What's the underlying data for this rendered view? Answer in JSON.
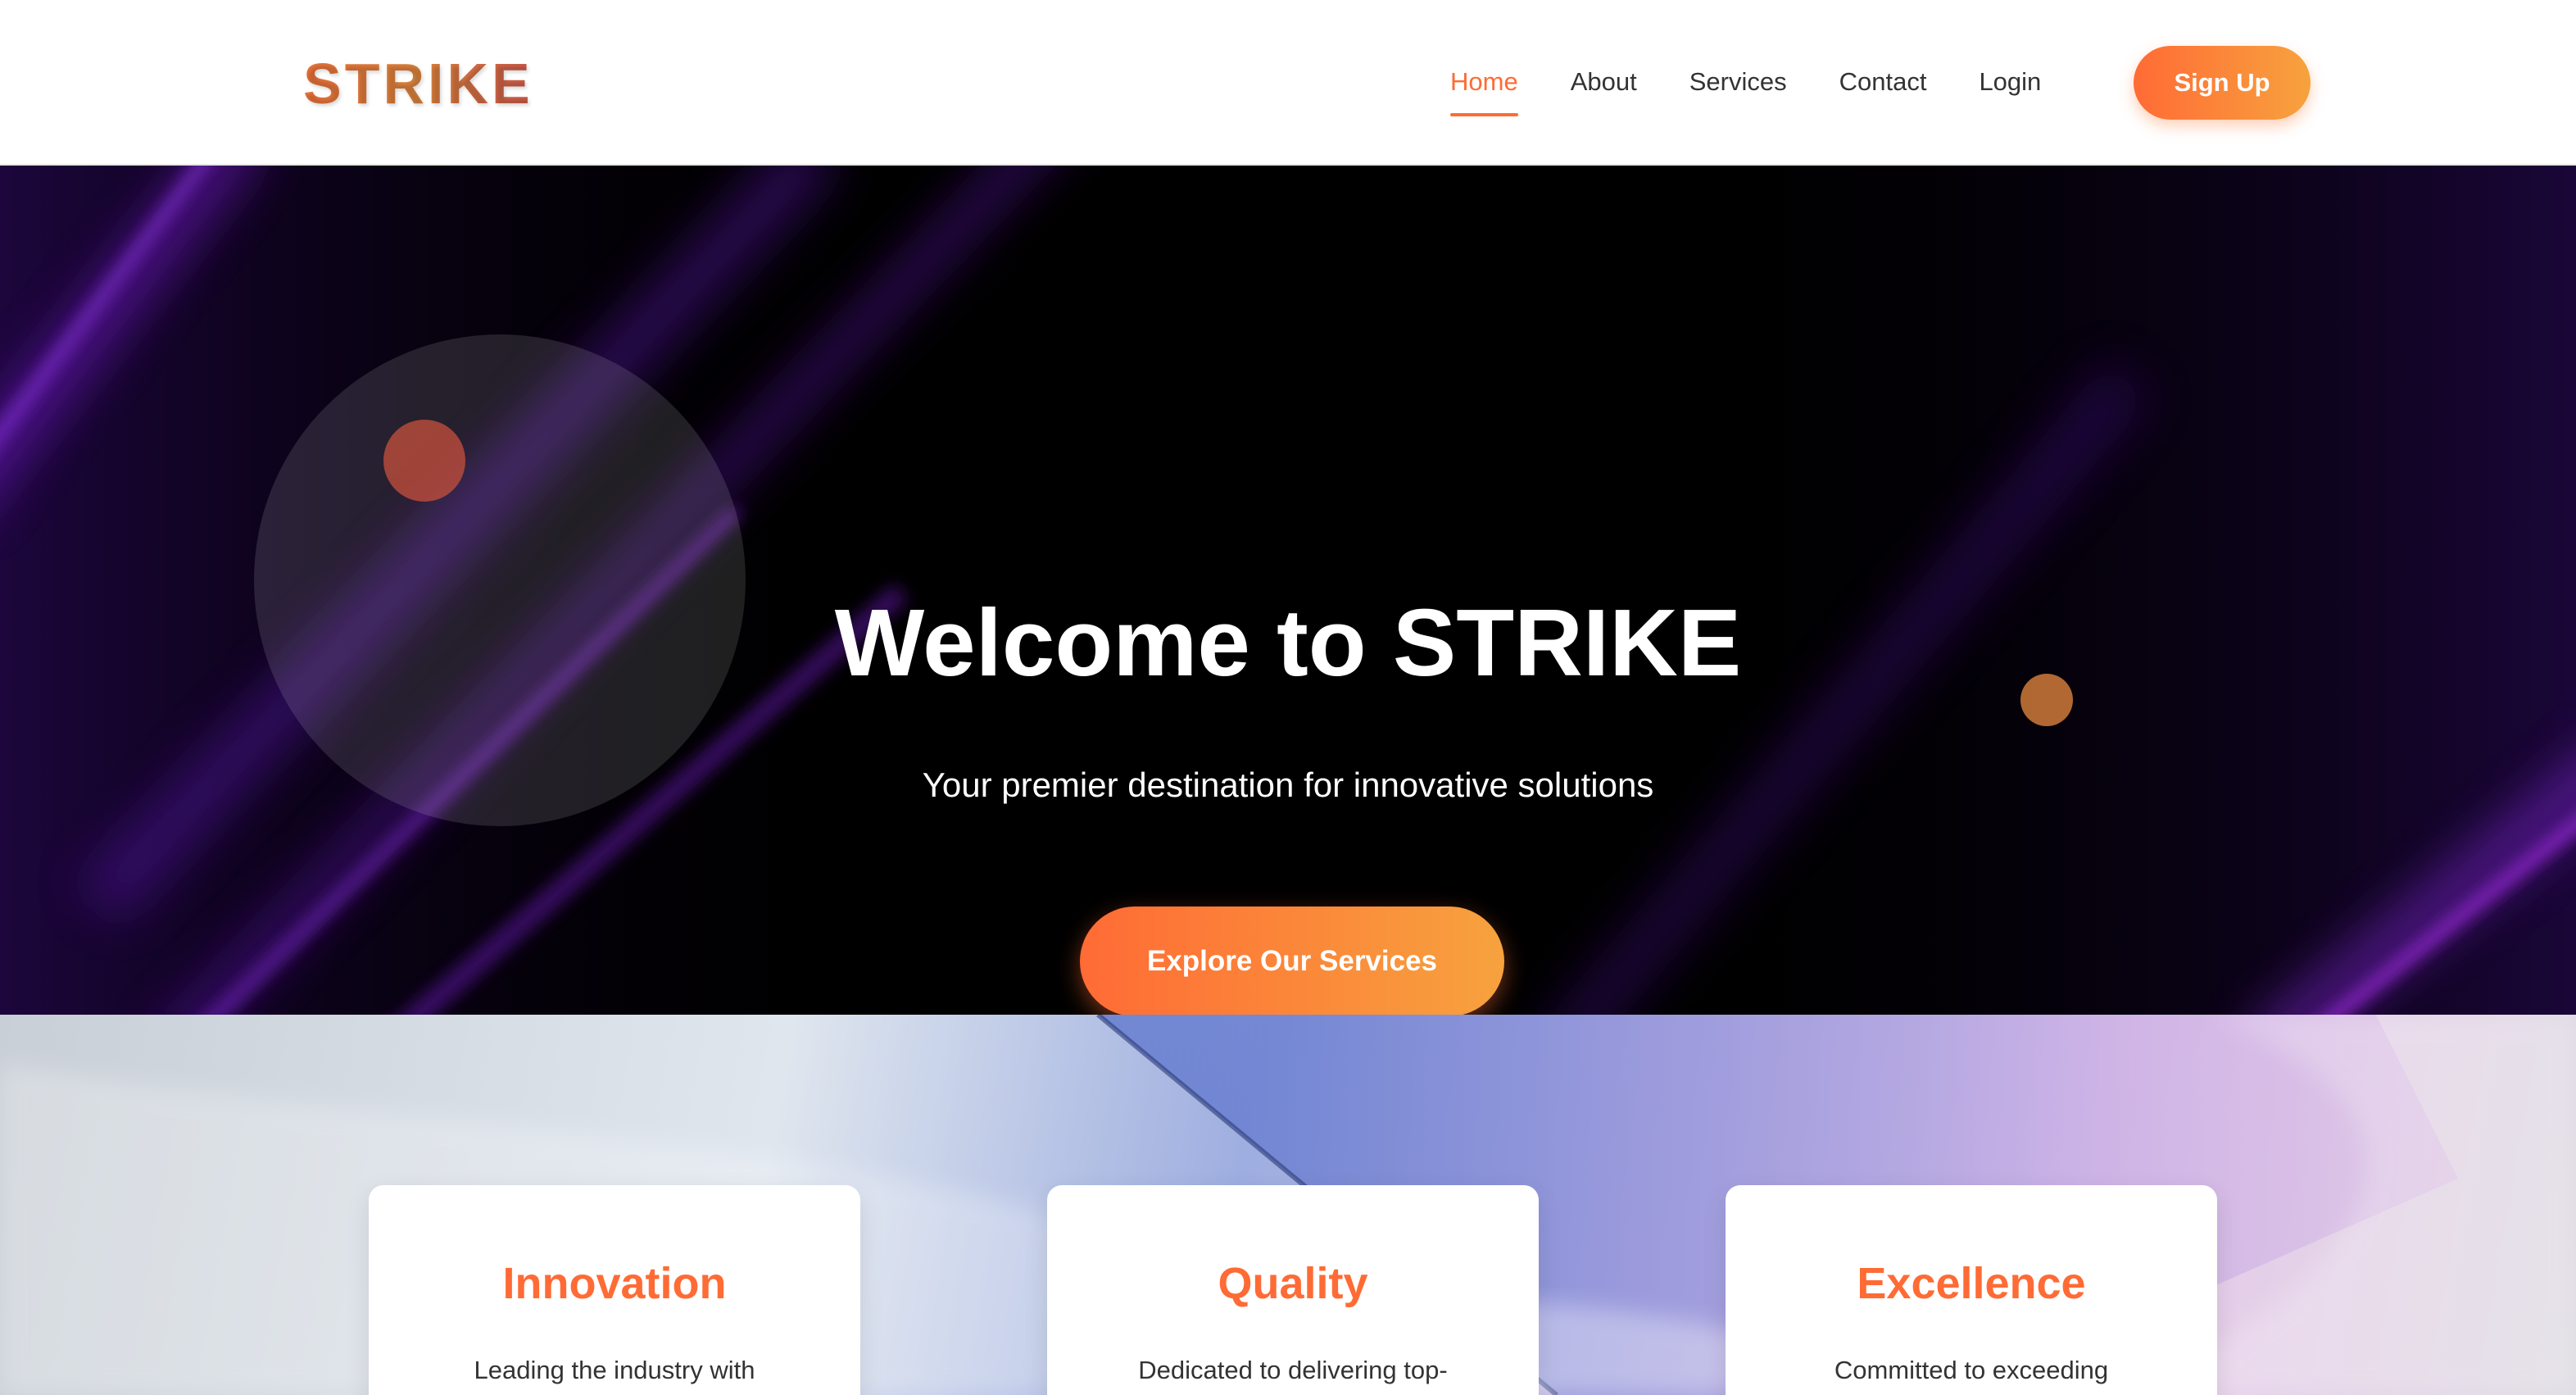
{
  "brand": {
    "logo_text": "STRIKE"
  },
  "nav": {
    "items": [
      {
        "label": "Home",
        "active": true
      },
      {
        "label": "About",
        "active": false
      },
      {
        "label": "Services",
        "active": false
      },
      {
        "label": "Contact",
        "active": false
      },
      {
        "label": "Login",
        "active": false
      }
    ],
    "signup_label": "Sign Up"
  },
  "hero": {
    "title": "Welcome to STRIKE",
    "subtitle": "Your premier destination for innovative solutions",
    "cta_label": "Explore Our Services"
  },
  "features": {
    "cards": [
      {
        "title": "Innovation",
        "text": "Leading the industry with"
      },
      {
        "title": "Quality",
        "text": "Dedicated to delivering top-"
      },
      {
        "title": "Excellence",
        "text": "Committed to exceeding"
      }
    ]
  },
  "colors": {
    "accent": "#ff6b35",
    "accent_end": "#f7a23e",
    "hero_background": "#000000",
    "hero_glow": "#7b1fd6",
    "text_dark": "#333333"
  }
}
